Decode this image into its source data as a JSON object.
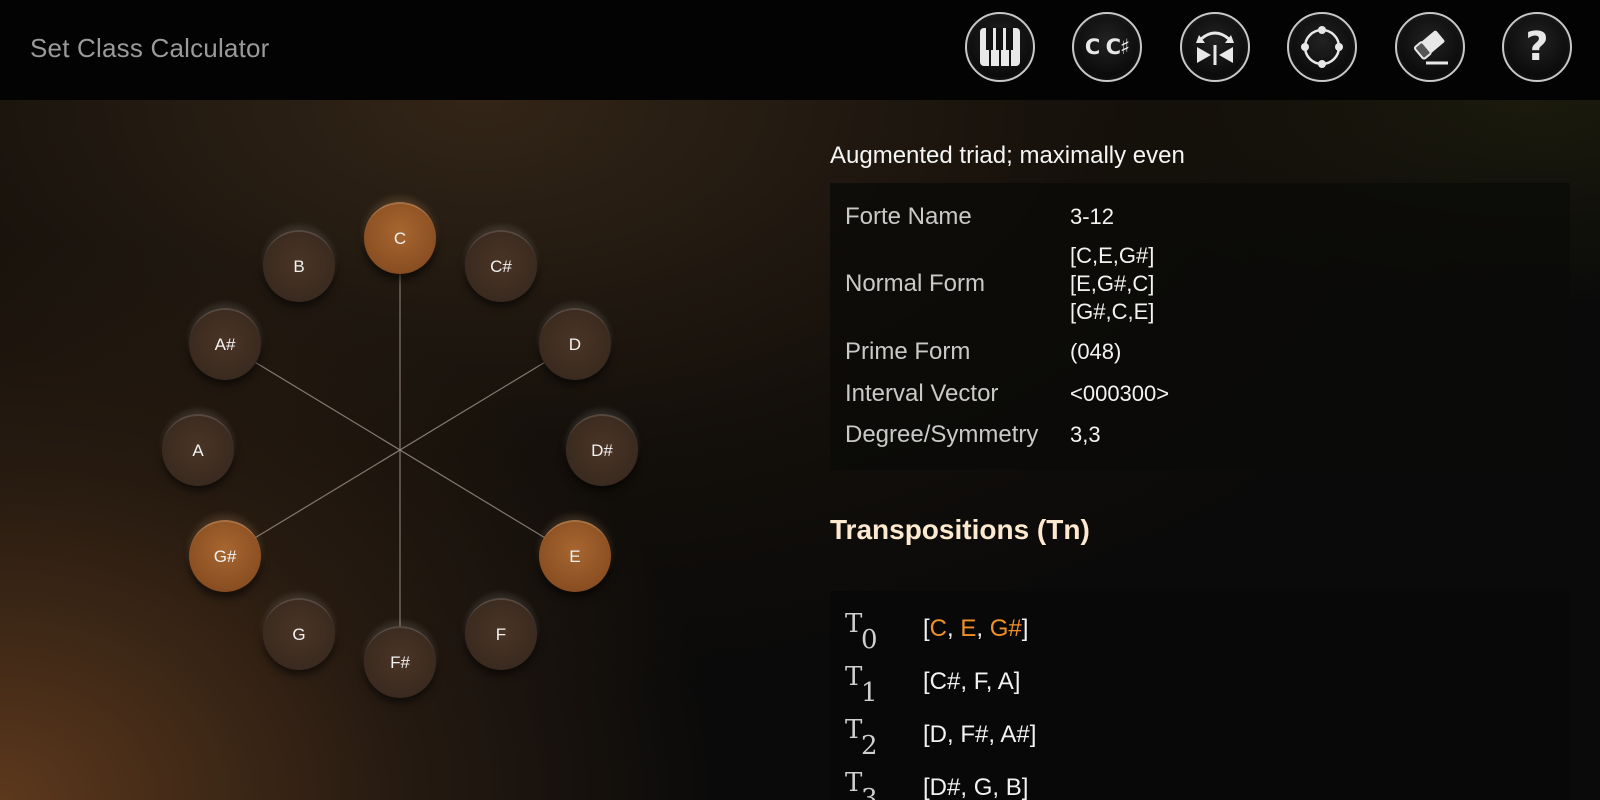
{
  "app": {
    "title": "Set Class Calculator"
  },
  "toolbar": {
    "piano": {
      "icon": "piano-keys-icon"
    },
    "note_names": {
      "label": "C C♯",
      "icon": "note-names-icon"
    },
    "invert": {
      "icon": "invert-mirror-icon"
    },
    "circle": {
      "icon": "circle-dots-icon"
    },
    "clear": {
      "icon": "eraser-icon"
    },
    "help": {
      "label": "?",
      "icon": "help-icon"
    }
  },
  "wheel": {
    "notes": [
      {
        "name": "C",
        "active": true
      },
      {
        "name": "C#",
        "active": false
      },
      {
        "name": "D",
        "active": false
      },
      {
        "name": "D#",
        "active": false
      },
      {
        "name": "E",
        "active": true
      },
      {
        "name": "F",
        "active": false
      },
      {
        "name": "F#",
        "active": false
      },
      {
        "name": "G",
        "active": false
      },
      {
        "name": "G#",
        "active": true
      },
      {
        "name": "A",
        "active": false
      },
      {
        "name": "A#",
        "active": false
      },
      {
        "name": "B",
        "active": false
      }
    ],
    "colors": {
      "active": "#9a5a28",
      "inactive": "#3d2c20",
      "line": "#9c9186"
    }
  },
  "info": {
    "description": "Augmented triad; maximally even",
    "properties": {
      "forte_label": "Forte Name",
      "forte_value": "3-12",
      "normal_label": "Normal Form",
      "normal_values": [
        "[C,E,G#]",
        "[E,G#,C]",
        "[G#,C,E]"
      ],
      "prime_label": "Prime Form",
      "prime_value": "(048)",
      "vector_label": "Interval Vector",
      "vector_value": "<000300>",
      "degree_label": "Degree/Symmetry",
      "degree_value": "3,3"
    },
    "transpositions_title": "Transpositions (Tn)",
    "transpositions": [
      {
        "symbol": "T",
        "index": "0",
        "notes": [
          "C",
          "E",
          "G#"
        ],
        "highlight": true
      },
      {
        "symbol": "T",
        "index": "1",
        "notes": [
          "C#",
          "F",
          "A"
        ],
        "highlight": false
      },
      {
        "symbol": "T",
        "index": "2",
        "notes": [
          "D",
          "F#",
          "A#"
        ],
        "highlight": false
      },
      {
        "symbol": "T",
        "index": "3",
        "notes": [
          "D#",
          "G",
          "B"
        ],
        "highlight": false
      }
    ],
    "colors": {
      "highlight": "#f0902a"
    }
  }
}
